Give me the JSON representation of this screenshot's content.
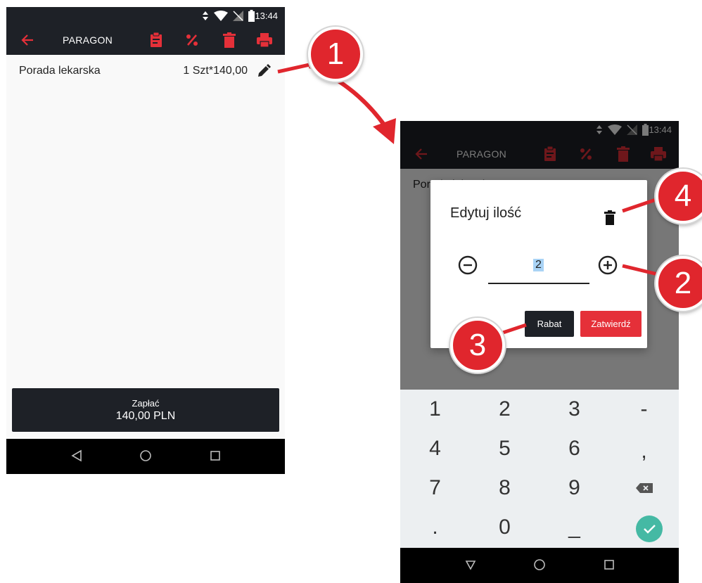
{
  "status_bar": {
    "time": "13:44"
  },
  "app_bar": {
    "title": "PARAGON"
  },
  "receipt": {
    "items": [
      {
        "name": "Porada lekarska",
        "quantity": "1 Szt*140,00"
      }
    ],
    "pay_label": "Zapłać",
    "pay_amount": "140,00 PLN"
  },
  "dialog": {
    "title": "Edytuj ilość",
    "quantity": "2",
    "discount_label": "Rabat",
    "confirm_label": "Zatwierdź"
  },
  "keyboard": {
    "rows": [
      [
        "1",
        "2",
        "3",
        "-"
      ],
      [
        "4",
        "5",
        "6",
        ","
      ],
      [
        "7",
        "8",
        "9",
        "⌫"
      ],
      [
        ".",
        "0",
        "_",
        "✓"
      ]
    ]
  },
  "callouts": [
    "1",
    "2",
    "3",
    "4"
  ],
  "colors": {
    "accent": "#e53039",
    "appbar": "#1e2127",
    "confirm_key": "#45b9a4",
    "callout": "#e0262d"
  },
  "icons": {
    "toolbar": [
      "back-arrow-icon",
      "clipboard-icon",
      "percent-icon",
      "trash-icon",
      "printer-icon"
    ],
    "navbar": [
      "back-triangle-icon",
      "home-circle-icon",
      "recents-square-icon"
    ]
  }
}
